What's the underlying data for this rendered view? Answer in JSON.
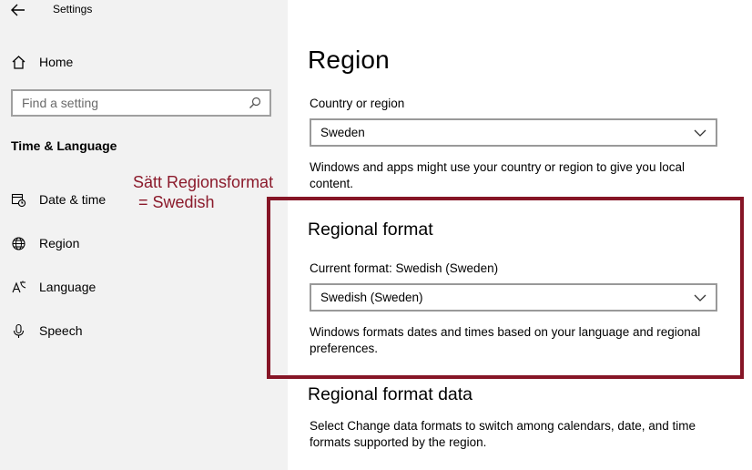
{
  "window": {
    "title": "Settings"
  },
  "sidebar": {
    "home_label": "Home",
    "search_placeholder": "Find a setting",
    "section_title": "Time & Language",
    "items": [
      {
        "label": "Date & time",
        "icon": "calendar-clock-icon"
      },
      {
        "label": "Region",
        "icon": "globe-icon"
      },
      {
        "label": "Language",
        "icon": "language-icon"
      },
      {
        "label": "Speech",
        "icon": "microphone-icon"
      }
    ]
  },
  "annotation": {
    "line1": "Sätt Regionsformat",
    "line2": "= Swedish",
    "color": "#8b1a2b"
  },
  "main": {
    "title": "Region",
    "country": {
      "label": "Country or region",
      "value": "Sweden",
      "description": "Windows and apps might use your country or region to give you local content."
    },
    "regional_format": {
      "heading": "Regional format",
      "current_label": "Current format: Swedish (Sweden)",
      "value": "Swedish (Sweden)",
      "description": "Windows formats dates and times based on your language and regional preferences."
    },
    "regional_format_data": {
      "heading": "Regional format data",
      "description": "Select Change data formats to switch among calendars, date, and time formats supported by the region."
    }
  },
  "colors": {
    "highlight_border": "#861526",
    "sidebar_bg": "#f2f2f2"
  }
}
